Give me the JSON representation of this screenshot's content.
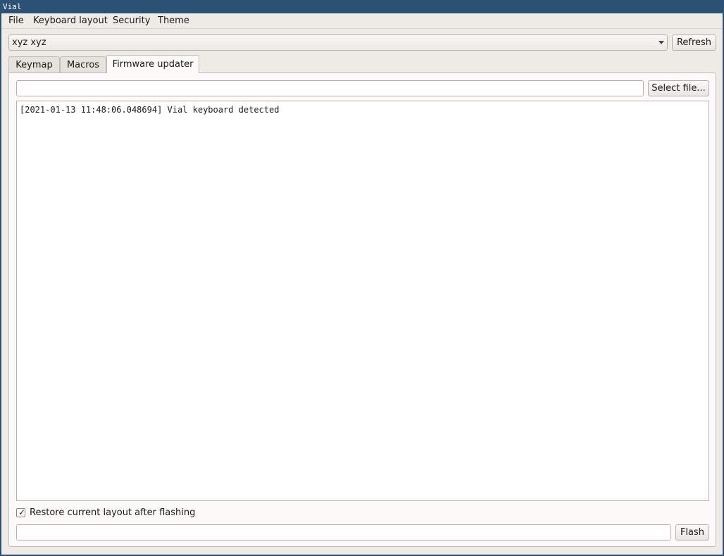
{
  "window": {
    "title": "Vial"
  },
  "menubar": {
    "items": [
      "File",
      "Keyboard layout",
      "Security",
      "Theme"
    ]
  },
  "device_selector": {
    "value": "xyz xyz",
    "refresh_label": "Refresh"
  },
  "tabs": [
    {
      "label": "Keymap",
      "active": false
    },
    {
      "label": "Macros",
      "active": false
    },
    {
      "label": "Firmware updater",
      "active": true
    }
  ],
  "firmware": {
    "file_path": "",
    "select_file_label": "Select file...",
    "log": "[2021-01-13 11:48:06.048694] Vial keyboard detected",
    "restore_label": "Restore current layout after flashing",
    "restore_checked": true,
    "progress_text": "",
    "flash_label": "Flash"
  }
}
